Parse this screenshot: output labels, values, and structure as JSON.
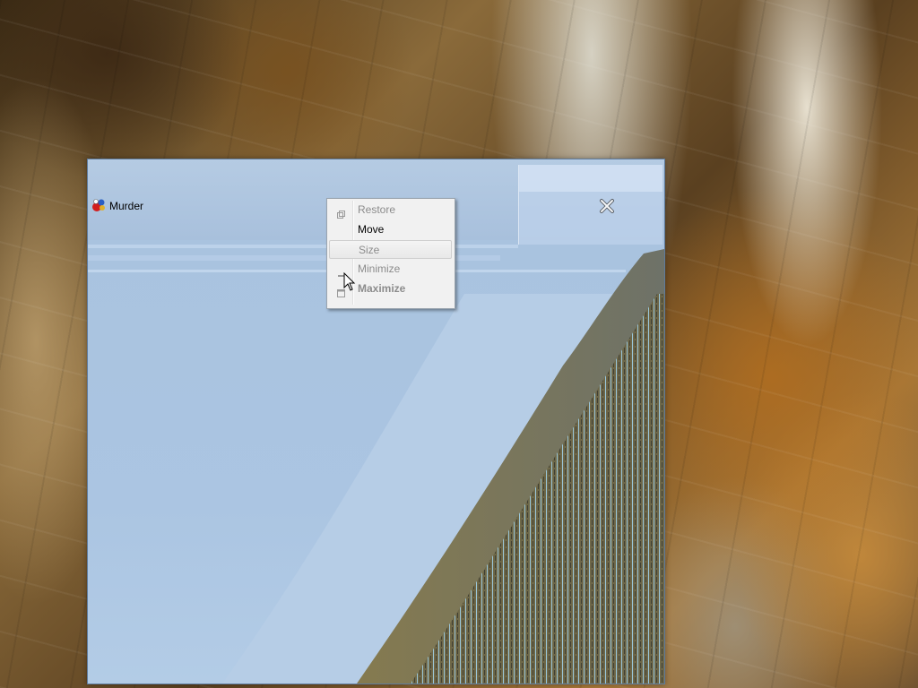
{
  "window": {
    "title": "Murder",
    "app_icon": "murder-app-icon",
    "close_icon": "close-x-icon"
  },
  "context_menu": {
    "items": [
      {
        "label": "Restore",
        "enabled": false,
        "icon": "restore-icon"
      },
      {
        "label": "Move",
        "enabled": true
      },
      {
        "label": "Size",
        "enabled": false,
        "highlighted": true
      },
      {
        "label": "Minimize",
        "enabled": false,
        "icon": "minimize-icon"
      },
      {
        "label": "Maximize",
        "enabled": false,
        "bold": true,
        "icon": "maximize-icon"
      }
    ]
  },
  "cursor": "arrow-cursor-icon",
  "colors": {
    "window_bg": "#a9c3df",
    "menu_bg": "#f1f1f1",
    "disabled_text": "#8c8c8c"
  }
}
